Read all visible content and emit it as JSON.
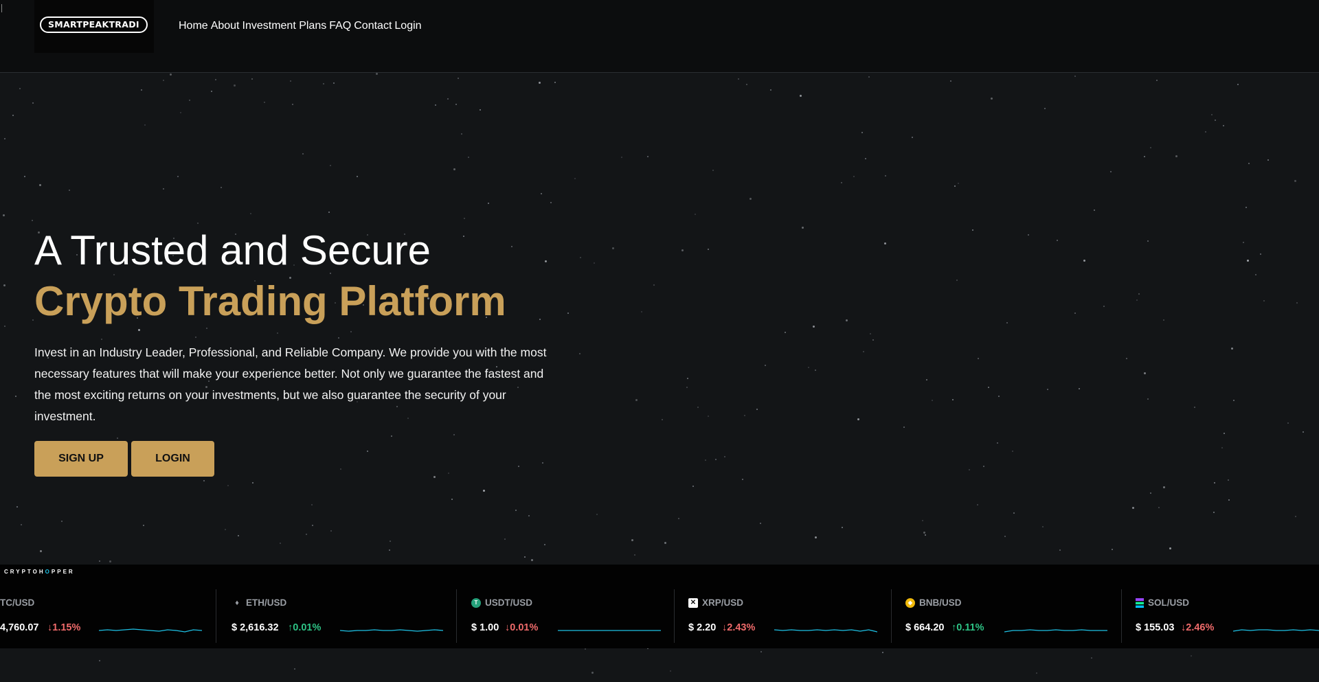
{
  "brand": {
    "logo_text": "SMARTPEAKTRADI"
  },
  "nav": {
    "items": [
      "Home",
      "About",
      "Investment Plans",
      "FAQ",
      "Contact",
      "Login"
    ]
  },
  "hero": {
    "title_line1": "A Trusted and Secure",
    "title_line2": "Crypto Trading Platform",
    "description": "Invest in an Industry Leader, Professional, and Reliable Company. We provide you with the most necessary features that will make your experience better. Not only we guarantee the fastest and the most exciting returns on your investments, but we also guarantee the security of your investment.",
    "signup_label": "SIGN UP",
    "login_label": "LOGIN"
  },
  "ticker": {
    "brand_pre": "CRYPTOH",
    "brand_o": "O",
    "brand_post": "PPER",
    "items": [
      {
        "pair": "TC/USD",
        "price": "4,760.07",
        "change": "1.15%",
        "direction": "down",
        "icon": "bitcoin-icon",
        "spark": [
          14,
          13,
          14,
          13,
          12,
          13,
          14,
          15,
          13,
          14,
          16,
          13,
          14
        ]
      },
      {
        "pair": "ETH/USD",
        "price": "$ 2,616.32",
        "change": "0.01%",
        "direction": "up",
        "icon": "ethereum-icon",
        "spark": [
          14,
          15,
          14,
          14,
          13,
          14,
          14,
          13,
          14,
          15,
          14,
          13,
          14
        ]
      },
      {
        "pair": "USDT/USD",
        "price": "$ 1.00",
        "change": "0.01%",
        "direction": "down",
        "icon": "tether-icon",
        "spark": [
          14,
          14,
          14,
          14,
          14,
          14,
          14,
          14,
          14,
          14,
          14,
          14,
          14
        ]
      },
      {
        "pair": "XRP/USD",
        "price": "$ 2.20",
        "change": "2.43%",
        "direction": "down",
        "icon": "xrp-icon",
        "spark": [
          13,
          14,
          13,
          14,
          14,
          13,
          14,
          13,
          14,
          13,
          15,
          13,
          16
        ]
      },
      {
        "pair": "BNB/USD",
        "price": "$ 664.20",
        "change": "0.11%",
        "direction": "up",
        "icon": "bnb-icon",
        "spark": [
          16,
          14,
          14,
          13,
          14,
          14,
          13,
          14,
          14,
          13,
          14,
          14,
          14
        ]
      },
      {
        "pair": "SOL/USD",
        "price": "$ 155.03",
        "change": "2.46%",
        "direction": "down",
        "icon": "solana-icon",
        "spark": [
          15,
          13,
          14,
          13,
          13,
          14,
          14,
          13,
          14,
          13,
          14,
          14,
          13
        ]
      }
    ]
  },
  "colors": {
    "accent": "#c9a059",
    "up": "#2ec486",
    "down": "#f06b6b",
    "spark": "#1ec2e6"
  }
}
